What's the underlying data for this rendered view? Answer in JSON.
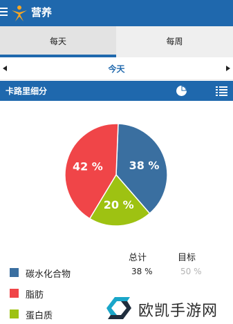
{
  "app": {
    "title": "营养"
  },
  "tabs": [
    {
      "label": "每天"
    },
    {
      "label": "每周"
    }
  ],
  "day_nav": {
    "label": "今天"
  },
  "section": {
    "title": "卡路里细分"
  },
  "colors": {
    "primary": "#1f68ad",
    "carbs": "#3a6fa0",
    "fat": "#f04548",
    "protein": "#9ec212"
  },
  "chart_data": {
    "type": "pie",
    "slices": [
      {
        "label": "碳水化合物",
        "value": 38,
        "text": "38 %",
        "color": "#3a6fa0"
      },
      {
        "label": "蛋白质",
        "value": 20,
        "text": "20 %",
        "color": "#9ec212"
      },
      {
        "label": "脂肪",
        "value": 42,
        "text": "42 %",
        "color": "#f04548"
      }
    ]
  },
  "breakdown": {
    "header_total": "总计",
    "header_goal": "目标",
    "rows": [
      {
        "label": "碳水化合物",
        "total": "38 %",
        "goal": "50 %"
      },
      {
        "label": "脂肪"
      },
      {
        "label": "蛋白质"
      }
    ]
  },
  "watermark": {
    "text": "欧凯手游网"
  },
  "icons": [
    "menu-icon",
    "app-logo-icon",
    "chevron-left-icon",
    "chevron-right-icon",
    "pie-chart-icon",
    "list-view-icon"
  ]
}
